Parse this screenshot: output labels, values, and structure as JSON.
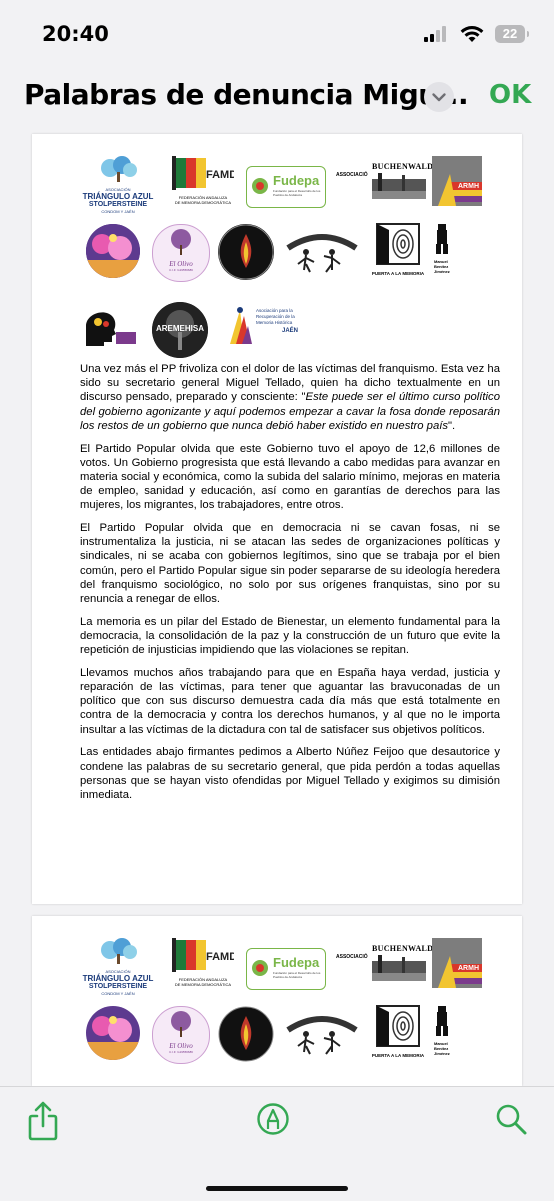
{
  "status_bar": {
    "time": "20:40",
    "battery": "22"
  },
  "nav": {
    "title": "Palabras de denuncia Migu...",
    "ok_label": "OK"
  },
  "logos": {
    "l1": {
      "line1": "ASOCIACIÓN",
      "line2": "TRIÁNGULO AZUL",
      "line3": "STOLPERSTEINE",
      "line4": "CONDOM Y JAÉN"
    },
    "l2": {
      "abbr": "FAMD",
      "line1": "FEDERACIÓN ANDALUZA",
      "line2": "DE MEMORIA DEMOCRÁTICA"
    },
    "l3": {
      "name": "Fudepa",
      "sub": "Fundación para el Desarrollo de los Pueblos de Andalucía"
    },
    "l4": {
      "name": "ASSOCIACIÓ"
    },
    "l5": {
      "name": "BUCHENWALD"
    },
    "l6": {
      "name": "ARMH"
    },
    "l8": {
      "name": "El Olivo",
      "sub": "C.I.F: G19556686"
    },
    "l11": {
      "name": "PUERTA A LA MEMORIA"
    },
    "l12": {
      "name": "Manuel Benítez Jiménez"
    },
    "l14": {
      "name": "AREMEHISA"
    },
    "l15": {
      "line1": "Asociación para la",
      "line2": "Recuperación de la",
      "line3": "Memoria Histórica",
      "line4": "JAÉN"
    }
  },
  "letter": {
    "p1_a": "Una vez más el PP frivoliza con el dolor de las víctimas del franquismo. Esta vez ha sido su secretario general Miguel Tellado, quien ha dicho textualmente en un discurso pensado, preparado y consciente: \"",
    "p1_quote": "Este puede ser el último curso político del gobierno agonizante y aquí podemos empezar a cavar la fosa donde reposarán los restos de un gobierno que nunca debió haber existido en nuestro país",
    "p1_b": "\".",
    "p2": "El Partido Popular olvida que este Gobierno tuvo el apoyo de 12,6 millones de votos. Un Gobierno progresista que está llevando a cabo medidas para avanzar en materia social y económica, como la subida del salario mínimo, mejoras en materia de empleo, sanidad y educación, así como en garantías de derechos para las mujeres, los migrantes, los trabajadores, entre otros.",
    "p3": "El Partido Popular olvida que en democracia ni se cavan fosas, ni se instrumentaliza la justicia, ni se atacan las sedes de organizaciones políticas y sindicales, ni se acaba con gobiernos legítimos, sino que se trabaja por el bien común, pero el Partido Popular sigue sin poder separarse de su ideología heredera del franquismo sociológico, no solo por sus orígenes franquistas, sino por su renuncia a renegar de ellos.",
    "p4": "La memoria es un pilar del Estado de Bienestar, un elemento fundamental para la democracia, la consolidación de la paz y la construcción de un futuro que evite la repetición de injusticias impidiendo que las violaciones se repitan.",
    "p5": "Llevamos muchos años trabajando para que en España haya verdad, justicia y reparación de las víctimas, para tener que aguantar las bravuconadas de un político que con sus discurso demuestra cada día más que está totalmente en contra de la democracia y contra los derechos humanos, y al que no le importa insultar a las víctimas de la dictadura con tal de satisfacer sus objetivos políticos.",
    "p6": "Las entidades abajo firmantes pedimos a Alberto Núñez Feijoo que desautorice y condene las palabras de su secretario general, que pida perdón a todas aquellas personas que se hayan visto ofendidas por Miguel Tellado y exigimos su dimisión inmediata."
  },
  "toolbar": {
    "share": "share-icon",
    "markup": "markup-icon",
    "search": "search-icon"
  },
  "colors": {
    "accent_green": "#34a853"
  }
}
